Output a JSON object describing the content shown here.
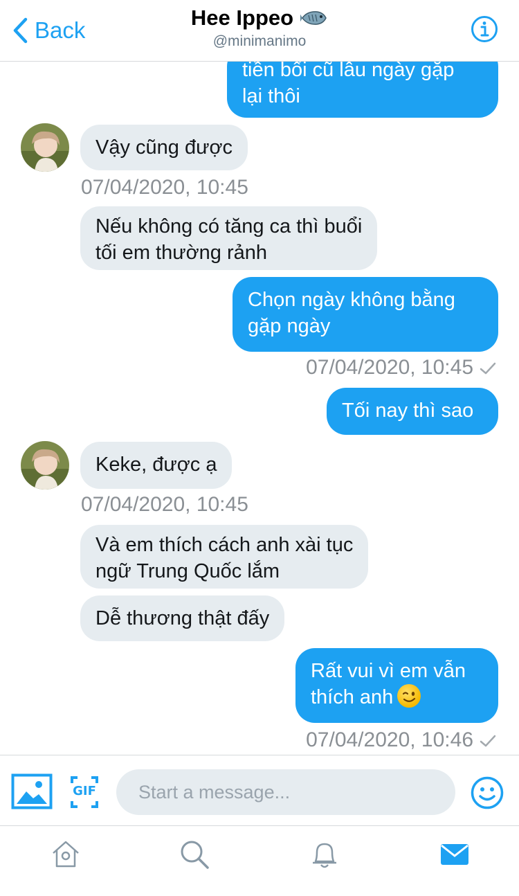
{
  "header": {
    "back_label": "Back",
    "title": "Hee Ippeo",
    "handle": "@minimanimo",
    "title_icon": "fish-icon",
    "info_icon": "info-icon"
  },
  "messages": [
    {
      "side": "out",
      "lines": [
        "tiền bối cũ lâu ngày gặp",
        "lại thôi"
      ]
    },
    {
      "side": "in",
      "text": "Vậy cũng được"
    },
    {
      "side": "timestamp",
      "text": "07/04/2020, 10:45"
    },
    {
      "side": "in",
      "lines": [
        "Nếu không có tăng ca thì buổi",
        "tối em thường rảnh"
      ]
    },
    {
      "side": "out",
      "lines": [
        "Chọn ngày không bằng",
        "gặp ngày"
      ]
    },
    {
      "side": "timestamp",
      "text": "07/04/2020, 10:45",
      "read": true
    },
    {
      "side": "out",
      "text": "Tối nay thì sao"
    },
    {
      "side": "in",
      "text": "Keke, được ạ"
    },
    {
      "side": "timestamp",
      "text": "07/04/2020, 10:45"
    },
    {
      "side": "in",
      "lines": [
        "Và em thích cách anh xài tục",
        "ngữ Trung Quốc lắm"
      ]
    },
    {
      "side": "in",
      "text": "Dễ thương thật đấy"
    },
    {
      "side": "out",
      "lines": [
        "Rất vui vì em vẫn",
        "thích anh"
      ],
      "emoji": "winking-face-emoji"
    },
    {
      "side": "timestamp",
      "text": "07/04/2020, 10:46",
      "read": true
    }
  ],
  "composer": {
    "placeholder": "Start a message...",
    "value": "",
    "gif_label": "GIF"
  },
  "tabs": [
    "home-icon",
    "search-icon",
    "notifications-icon",
    "messages-icon"
  ],
  "colors": {
    "accent": "#1da1f2",
    "incoming_bubble": "#e6ecf0",
    "timestamp": "#8a8f94",
    "divider": "#d6d9dc"
  }
}
